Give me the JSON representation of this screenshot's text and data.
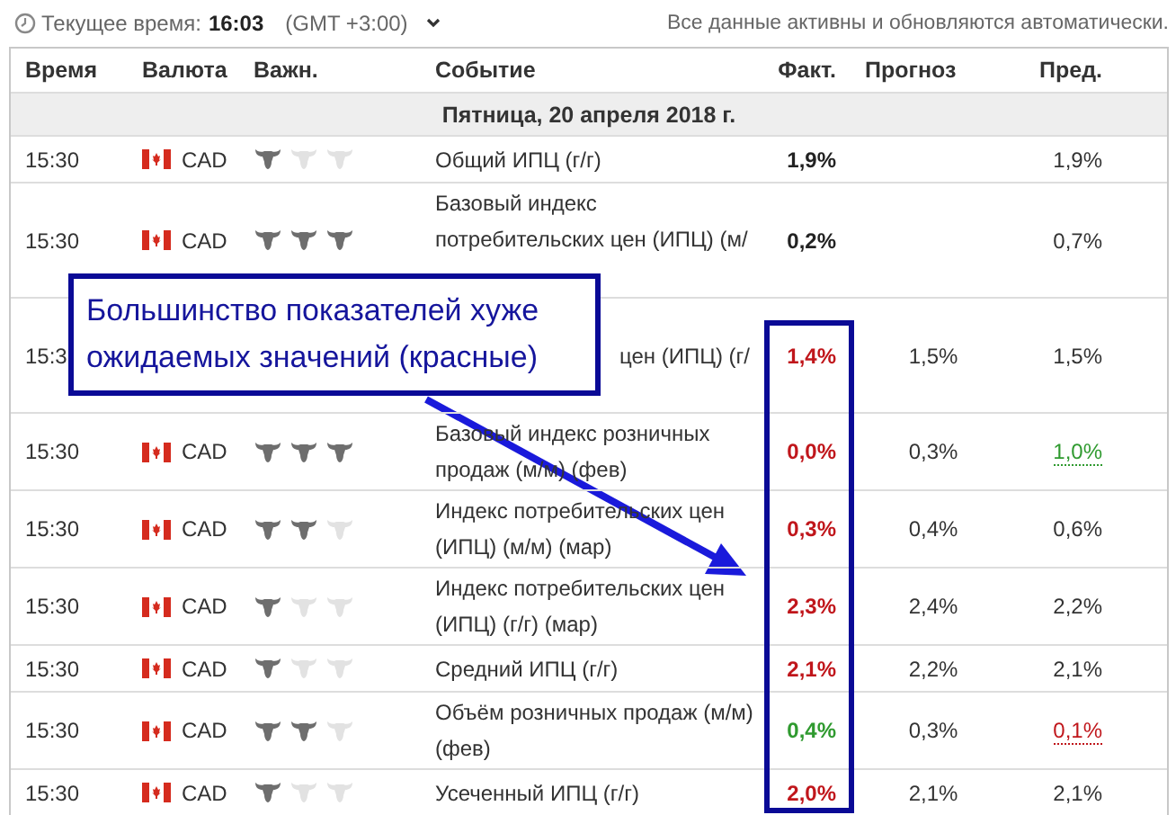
{
  "topbar": {
    "time_label": "Текущее время:",
    "time": "16:03",
    "timezone": "(GMT +3:00)",
    "notice": "Все данные активны и обновляются автоматически."
  },
  "table": {
    "columns": [
      "Время",
      "Валюта",
      "Важн.",
      "Событие",
      "Факт.",
      "Прогноз",
      "Пред."
    ],
    "date": "Пятница, 20 апреля 2018 г.",
    "rows": [
      {
        "kind": "normal",
        "time": "15:30",
        "currency": "CAD",
        "stars": 1,
        "event": "Общий ИПЦ (г/г)",
        "actual": "1,9%",
        "worse": false,
        "better": false,
        "previous": "1,9%",
        "previous_up": false,
        "previous_down": false
      },
      {
        "kind": "cut_below",
        "time": "15:30",
        "currency": "CAD",
        "stars": 3,
        "event": "Базовый индекс потребительских цен (ИПЦ) (м/",
        "actual": "0,2%",
        "worse": false,
        "better": false,
        "previous": "0,7%",
        "previous_up": false,
        "previous_down": false
      },
      {
        "kind": "cut_left",
        "time": "15:3",
        "event": "цен (ИПЦ) (г/",
        "actual": "1,4%",
        "worse": true,
        "better": false,
        "forecast": "1,5%",
        "previous": "1,5%",
        "previous_up": false,
        "previous_down": false
      },
      {
        "kind": "normal",
        "time": "15:30",
        "currency": "CAD",
        "stars": 3,
        "event": "Базовый индекс розничных продаж (м/м) (фев)",
        "actual": "0,0%",
        "worse": true,
        "better": false,
        "forecast": "0,3%",
        "previous": "1,0%",
        "previous_up": true,
        "previous_down": false
      },
      {
        "kind": "normal",
        "time": "15:30",
        "currency": "CAD",
        "stars": 2,
        "event": "Индекс потребительских цен (ИПЦ) (м/м) (мар)",
        "actual": "0,3%",
        "worse": true,
        "better": false,
        "forecast": "0,4%",
        "previous": "0,6%",
        "previous_up": false,
        "previous_down": false
      },
      {
        "kind": "normal",
        "time": "15:30",
        "currency": "CAD",
        "stars": 1,
        "event": "Индекс потребительских цен (ИПЦ) (г/г) (мар)",
        "actual": "2,3%",
        "worse": true,
        "better": false,
        "forecast": "2,4%",
        "previous": "2,2%",
        "previous_up": false,
        "previous_down": false
      },
      {
        "kind": "normal",
        "time": "15:30",
        "currency": "CAD",
        "stars": 1,
        "event": "Средний ИПЦ (г/г)",
        "actual": "2,1%",
        "worse": true,
        "better": false,
        "forecast": "2,2%",
        "previous": "2,1%",
        "previous_up": false,
        "previous_down": false
      },
      {
        "kind": "normal",
        "time": "15:30",
        "currency": "CAD",
        "stars": 2,
        "event": "Объём розничных продаж (м/м) (фев)",
        "actual": "0,4%",
        "worse": false,
        "better": true,
        "forecast": "0,3%",
        "previous": "0,1%",
        "previous_up": false,
        "previous_down": true
      },
      {
        "kind": "normal",
        "time": "15:30",
        "currency": "CAD",
        "stars": 1,
        "event": "Усеченный ИПЦ (г/г)",
        "actual": "2,0%",
        "worse": true,
        "better": false,
        "forecast": "2,1%",
        "previous": "2,1%",
        "previous_up": false,
        "previous_down": false
      }
    ]
  },
  "callout": {
    "text": "Большинство показателей хуже ожидаемых значений (красные)"
  }
}
